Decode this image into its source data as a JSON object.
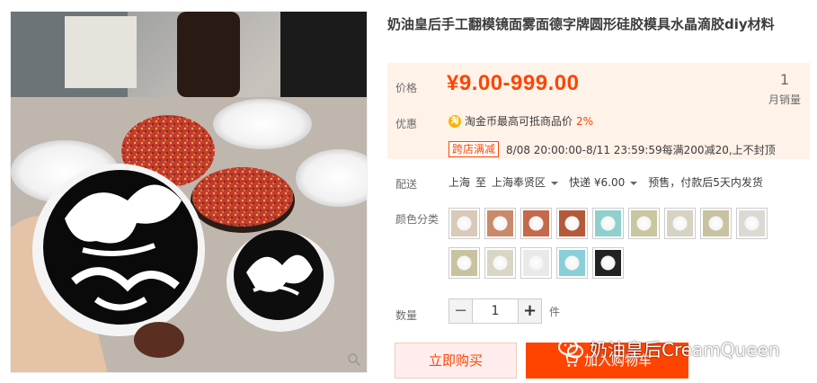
{
  "product": {
    "title": "奶油皇后手工翻模镜面雾面德字牌圆形硅胶模具水晶滴胶diy材料"
  },
  "price": {
    "label": "价格",
    "value": "¥9.00-999.00",
    "sales_count": "1",
    "sales_label": "月销量"
  },
  "promotion": {
    "label": "优惠",
    "coin_icon": "淘",
    "coin_text": "淘金币最高可抵商品价",
    "coin_pct": "2%",
    "tag": "跨店满减",
    "detail": "8/08 20:00:00-8/11 23:59:59每满200减20,上不封顶"
  },
  "shipping": {
    "label": "配送",
    "from": "上海",
    "to_label": "至",
    "to": "上海奉贤区",
    "method": "快递 ¥6.00",
    "presale": "预售，付款后5天内发货"
  },
  "colors": {
    "label": "颜色分类",
    "swatch_count_note": "",
    "swatches": [
      {
        "name": "swatch-1",
        "tone": "#d9c9b8"
      },
      {
        "name": "swatch-2",
        "tone": "#c98a6a"
      },
      {
        "name": "swatch-3",
        "tone": "#c46a4a"
      },
      {
        "name": "swatch-4",
        "tone": "#b45a3a"
      },
      {
        "name": "swatch-5",
        "tone": "#8fd0cf"
      },
      {
        "name": "swatch-6",
        "tone": "#c9c7a0"
      },
      {
        "name": "swatch-7",
        "tone": "#d6d3c2"
      },
      {
        "name": "swatch-8",
        "tone": "#c7c2a2"
      },
      {
        "name": "swatch-9",
        "tone": "#dcd9d2"
      },
      {
        "name": "swatch-10",
        "tone": "#c9c29f"
      },
      {
        "name": "swatch-11",
        "tone": "#d9d6c5"
      },
      {
        "name": "swatch-12",
        "tone": "#e9e9e9"
      },
      {
        "name": "swatch-13",
        "tone": "#88cfd9"
      },
      {
        "name": "swatch-14",
        "tone": "#222222"
      }
    ]
  },
  "quantity": {
    "label": "数量",
    "value": "1",
    "minus": "−",
    "plus": "+",
    "unit": "件"
  },
  "actions": {
    "buy_now": "立即购买",
    "add_to_cart": "加入购物车"
  },
  "watermark": {
    "text": "奶油皇后CreamQueen"
  },
  "colors_theme": {
    "accent": "#ff4400",
    "price_bg": "#fff2e8"
  }
}
